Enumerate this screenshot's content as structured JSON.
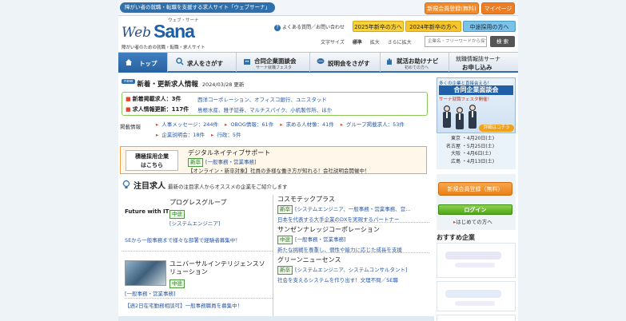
{
  "header": {
    "tagline": "障がい者の就職・転職を支援する求人サイト「ウェブサーナ」",
    "register_btn": "新規会員登録(無料)",
    "mypage_btn": "マイページ",
    "logo_web": "Web",
    "logo_sana": "Sana",
    "logo_ruby": "ウェブ・サーナ",
    "logo_sub": "障がい者のための就職・転職・求人サイト",
    "help_text": "よくある質問／お問い合わせ",
    "btn_2025": "2025年新卒の方へ",
    "btn_2024": "2024年新卒の方へ",
    "btn_mid": "中途採用の方へ",
    "font_size_label": "文字サイズ",
    "font_standard": "標準",
    "font_large": "拡大",
    "font_larger": "さらに拡大",
    "search_placeholder": "企業名・フリーワードから探す",
    "search_btn": "検 索"
  },
  "nav": {
    "items": [
      {
        "label": "トップ",
        "sub": ""
      },
      {
        "label": "求人をさがす",
        "sub": ""
      },
      {
        "label": "合同企業面談会",
        "sub": "サーナ就職フェスタ"
      },
      {
        "label": "説明会をさがす",
        "sub": ""
      },
      {
        "label": "就活お助けナビ",
        "sub": "初めての方へ"
      },
      {
        "label": "就職情報誌サーナ",
        "sub": "お申し込み"
      }
    ]
  },
  "news": {
    "badge": "new",
    "title": "新着・更新求人情報",
    "date": "2024/03/28 更新",
    "rows": [
      {
        "label": "新着掲載求人：3件",
        "links": "西洋コーポレーション、オフィスコ銀行、ユニスタッド"
      },
      {
        "label": "求人情報更新：117件",
        "links": "島根水産、雅子証券、マルチスパイク、小机製作所、ほか"
      }
    ]
  },
  "posts": {
    "label": "掲載情報",
    "items": [
      "人事メッセージ：244件",
      "OBOG情報：61件",
      "求める人材像：41件",
      "グループ掲載求人：53件",
      "企業説明会：18件",
      "行政：5件"
    ]
  },
  "corp": {
    "label": "積極採用企業はこちら",
    "name": "デジタルネイティブサポート",
    "tag": "新卒",
    "category": "[一般事務・営業事務]",
    "desc": "【オンライン・新卒対象】社員の多様な働き方が知れる！会社説明会開催中！"
  },
  "attention": {
    "title": "注目求人",
    "sub": "最新の注目求人からオススメの企業をご紹介します"
  },
  "left_jobs": [
    {
      "logo": "Future with IT",
      "name": "プログレスグループ",
      "tag": "中途",
      "category": "[システムエンジニア]",
      "msg": "SEから一般事務まで様々な部署で経験者募集中！"
    },
    {
      "name": "ユニバーサルインテリジェンスソリューション",
      "tag": "中途",
      "category": "[一般事務・営業事務]",
      "msg": "【週2日在宅勤務相談可】一般事務職員を募集中！"
    }
  ],
  "right_jobs": [
    {
      "name": "コスモテックプラス",
      "tag": "新卒",
      "category": "[システムエンジニア、一般事務・営業事務、営...",
      "msg": "日本を代表する大手企業のDXを実現するパートナー"
    },
    {
      "name": "サンゼンナレッジコーポレーション",
      "tag": "中途",
      "category": "[一般事務・営業事務]",
      "msg": "新たな挑戦を尊重し、個性や能力に応じた成長を支援"
    },
    {
      "name": "グリーンニューセンス",
      "tag": "新卒",
      "category": "[システムエンジニア、システムコンサルタント]",
      "msg": "社会を支えるシステムを作り出す！文理不問／SE職"
    }
  ],
  "sidebar": {
    "banner_top": "多くの企業と直接会える！",
    "banner_title": "合同企業面談会",
    "banner_sub": "サーナ就職フェスタ開催！",
    "banner_cta": "詳細はコチラ",
    "schedule": [
      {
        "city": "東京",
        "date": "4月20日(土)"
      },
      {
        "city": "名古屋",
        "date": "5月25日(土)"
      },
      {
        "city": "大阪",
        "date": "4月6日(土)"
      },
      {
        "city": "広島",
        "date": "4月13日(土)"
      }
    ],
    "register_btn": "新規会員登録（無料）",
    "login_btn": "ログイン",
    "first_time": "はじめての方へ",
    "recommend_title": "おすすめ企業"
  },
  "colors": {
    "brand_blue": "#1f5fa8",
    "accent_orange": "#ec7f17",
    "link_blue": "#2a58a8",
    "new_green": "#4a9a3a"
  }
}
